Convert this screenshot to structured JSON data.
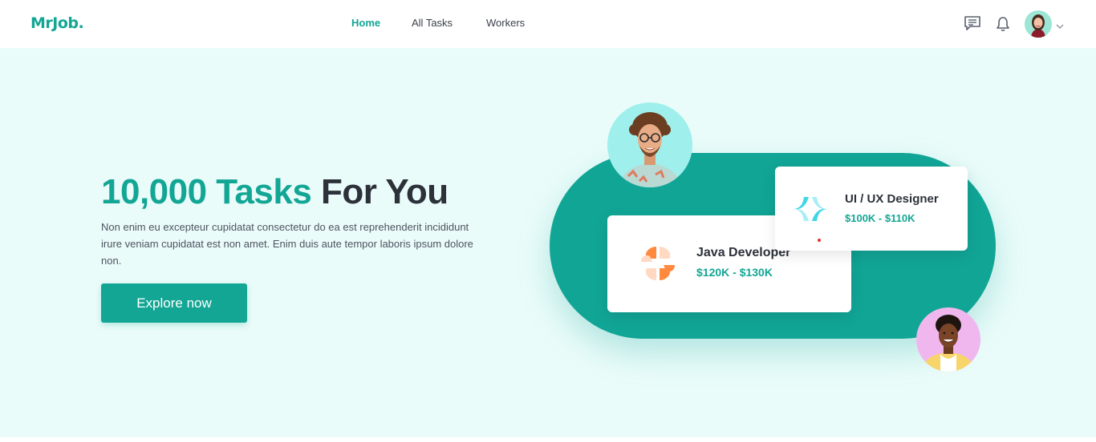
{
  "brand": {
    "logo_text": "MrJob.",
    "accent_color": "#13a695"
  },
  "nav": {
    "links": [
      {
        "label": "Home",
        "active": true
      },
      {
        "label": "All Tasks",
        "active": false
      },
      {
        "label": "Workers",
        "active": false
      }
    ]
  },
  "header_icons": [
    "message-icon",
    "bell-icon",
    "user-avatar",
    "chevron-down-icon"
  ],
  "hero": {
    "title_accent": "10,000 Tasks",
    "title_rest": "For You",
    "description": "Non enim eu excepteur cupidatat consectetur do ea est reprehenderit incididunt irure veniam cupidatat est non amet. Enim duis aute tempor laboris ipsum dolore non.",
    "cta_label": "Explore now"
  },
  "jobs": [
    {
      "title": "Java Developer",
      "salary": "$120K - $130K",
      "logo": "orange-flower-logo"
    },
    {
      "title": "UI / UX Designer",
      "salary": "$100K - $110K",
      "logo": "teal-star-logo"
    }
  ],
  "colors": {
    "hero_bg": "#eafcfa",
    "pill": "#11a596",
    "title_dark": "#2c313a"
  }
}
